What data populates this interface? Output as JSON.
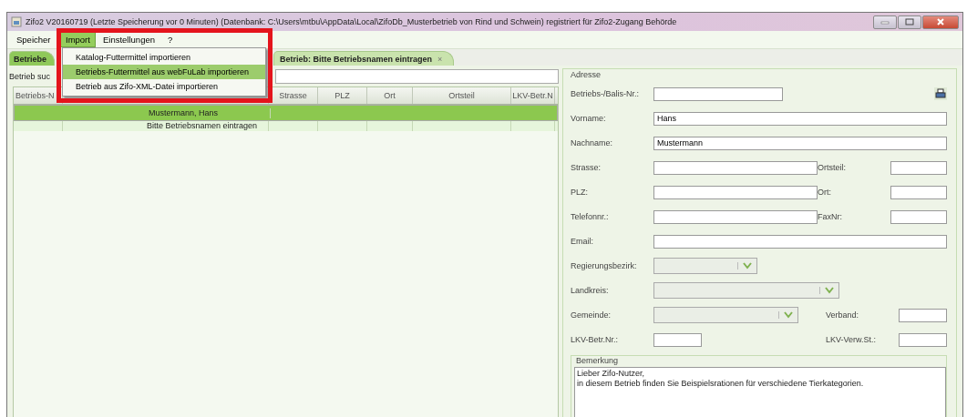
{
  "window": {
    "title": "Zifo2 V20160719 (Letzte Speicherung vor 0 Minuten) (Datenbank: C:\\Users\\mtbu\\AppData\\Local\\ZifoDb_Musterbetrieb von Rind und Schwein) registriert für Zifo2-Zugang Behörde"
  },
  "menu": [
    {
      "label": "Speicher",
      "selected": false
    },
    {
      "label": "Import",
      "selected": true
    },
    {
      "label": "Einstellungen",
      "selected": false
    },
    {
      "label": "?",
      "selected": false
    }
  ],
  "import_menu": [
    {
      "label": "Katalog-Futtermittel importieren",
      "selected": false
    },
    {
      "label": "Betriebs-Futtermittel aus webFuLab importieren",
      "selected": true
    },
    {
      "label": "Betrieb aus Zifo-XML-Datei importieren",
      "selected": false
    }
  ],
  "tabs": [
    {
      "label": "Betriebe",
      "selected": true
    },
    {
      "label": "Betrieb: Bitte Betriebsnamen eintragen",
      "selected": false,
      "close_icon": "×"
    }
  ],
  "search": {
    "label": "Betrieb suc"
  },
  "table": {
    "columns": [
      "Betriebs-N",
      "Strasse",
      "PLZ",
      "Ort",
      "Ortsteil",
      "LKV-Betr.N"
    ],
    "rows": [
      {
        "name": "Mustermann, Hans",
        "selected": true
      },
      {
        "name": "Bitte Betriebsnamen eintragen",
        "selected": false
      }
    ]
  },
  "address": {
    "title": "Adresse",
    "rows": [
      {
        "label": "Betriebs-/Balis-Nr.:",
        "kind": "text",
        "value": "",
        "print_button": true
      },
      {
        "label": "Vorname:",
        "kind": "text",
        "value": "Hans"
      },
      {
        "label": "Nachname:",
        "kind": "text",
        "value": "Mustermann"
      },
      {
        "label": "Strasse:",
        "kind": "text",
        "value": "",
        "extra": {
          "label": "Ortsteil:"
        }
      },
      {
        "label": "PLZ:",
        "kind": "text",
        "value": "",
        "extra": {
          "label": "Ort:"
        }
      },
      {
        "label": "Telefonnr.:",
        "kind": "text",
        "value": "",
        "extra": {
          "label": "FaxNr:"
        }
      },
      {
        "label": "Email:",
        "kind": "text",
        "value": ""
      },
      {
        "label": "Regierungsbezirk:",
        "kind": "select",
        "disabled": true
      },
      {
        "label": "Landkreis:",
        "kind": "select",
        "disabled": true
      },
      {
        "label": "Gemeinde:",
        "kind": "select",
        "disabled": true,
        "extra": {
          "label": "Verband:"
        }
      },
      {
        "label": "LKV-Betr.Nr.:",
        "kind": "text",
        "value": "",
        "extra": {
          "label": "LKV-Verw.St.:"
        }
      }
    ]
  },
  "remark": {
    "title": "Bemerkung",
    "lines": [
      "Lieber Zifo-Nutzer,",
      "in diesem Betrieb finden Sie Beispielsrationen für verschiedene Tierkategorien."
    ]
  }
}
